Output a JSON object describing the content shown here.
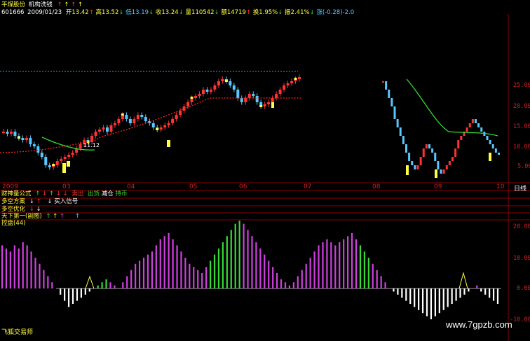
{
  "header": {
    "title_name": "平煤股份",
    "title_formula": "机构洗钱",
    "arrows": [
      "↑",
      "↑",
      "↑",
      "↑"
    ],
    "code": "601666",
    "date": "2009/01/23",
    "open_label": "开13.42",
    "high_label": "高13.52",
    "low_label": "低13.19",
    "close_label": "收13.24",
    "vol_label": "量110542",
    "amt_label": "额14719",
    "turn_label": "换1.95%",
    "amp_label": "振2.41%",
    "chg_label": "涨(-0.28)-2.0"
  },
  "price_panel": {
    "y_ticks": [
      "25.00",
      "20.00",
      "15.00",
      "10.00",
      "5.00"
    ],
    "x_ticks": [
      "2009",
      "03",
      "04",
      "05",
      "06",
      "07",
      "08",
      "09",
      "10"
    ],
    "period_label": "日线",
    "annotation": "11.12"
  },
  "indicator_rows": [
    {
      "label": "财神量公式",
      "signals": [
        "↑",
        "↓",
        "↑",
        "↓",
        "↓"
      ],
      "extra_red": "卖出",
      "extra_green": "出货",
      "extra_white": "减仓",
      "extra_green2": "持币"
    },
    {
      "label": "多空方案",
      "signals": [
        "↓",
        "↑",
        "↓"
      ],
      "extra_white": "买入信号"
    },
    {
      "label": "多空优化",
      "signals": [
        "↓",
        "↓"
      ]
    },
    {
      "label": "天下第一(副图)",
      "signals": [
        "↑",
        "↑",
        "↑",
        "↑"
      ]
    }
  ],
  "osc_panel": {
    "label": "控盘(44)",
    "y_ticks": [
      "20.00",
      "10.00",
      "0.00",
      "-10.00"
    ]
  },
  "footer": {
    "left_label": "飞狐交易师",
    "watermark": "www.7gpzb.com"
  },
  "colors": {
    "red": "#ff3333",
    "cyan": "#58c8ff",
    "yellow": "#ffff40",
    "green": "#33dd33",
    "magenta": "#d040e0",
    "grid_red": "#8a0000",
    "dotted_red": "#ff2020"
  },
  "chart_data": [
    {
      "type": "candlestick",
      "title": "",
      "x_ticks": [
        "2009",
        "03",
        "04",
        "05",
        "06",
        "07",
        "08",
        "09",
        "10"
      ],
      "ylim": [
        2,
        27
      ],
      "series": [
        {
          "name": "",
          "kind": "price_path",
          "values": [
            14,
            13.5,
            14,
            13,
            12.5,
            12,
            12.5,
            11,
            10.5,
            9,
            8,
            6,
            5.5,
            6,
            7,
            7.5,
            8,
            8.5,
            9,
            10,
            11,
            12,
            11.5,
            13,
            14,
            14.5,
            15,
            14,
            15.5,
            16,
            17,
            18,
            17,
            16,
            17,
            18,
            17.5,
            16.5,
            16,
            15,
            14.5,
            15,
            15.5,
            16,
            17,
            18,
            19,
            20,
            21,
            22,
            22.5,
            23,
            24,
            23.5,
            24,
            25,
            26,
            26.5,
            26,
            25,
            24,
            22,
            21,
            22,
            23,
            22.5,
            21,
            20,
            20.5,
            21,
            22,
            23,
            24,
            25,
            25.5,
            26,
            26.5,
            27
          ]
        },
        {
          "name": "",
          "kind": "price_path_2",
          "values": [
            26,
            24,
            22,
            20,
            17,
            15,
            13,
            11,
            9,
            7,
            6,
            5,
            6,
            8,
            10,
            11,
            10,
            9,
            7,
            5,
            4,
            5,
            6,
            7,
            8,
            10,
            12,
            13,
            14,
            15,
            16,
            17,
            16,
            15,
            14,
            13,
            12,
            11,
            10,
            9,
            8.5
          ]
        }
      ]
    },
    {
      "type": "bar",
      "title": "",
      "ylim": [
        -10,
        22
      ],
      "series": [
        {
          "name": "",
          "values": [
            14,
            13,
            12,
            14,
            13,
            15,
            14,
            12,
            10,
            8,
            6,
            4,
            2,
            0,
            -2,
            -4,
            -6,
            -5,
            -4,
            -3,
            -2,
            -1,
            0,
            1,
            2,
            3,
            2,
            1,
            0,
            2,
            4,
            6,
            8,
            9,
            10,
            11,
            12,
            14,
            16,
            17,
            18,
            16,
            14,
            12,
            10,
            8,
            7,
            6,
            5,
            7,
            9,
            11,
            13,
            15,
            17,
            19,
            21,
            22,
            21,
            19,
            17,
            15,
            13,
            11,
            9,
            7,
            5,
            3,
            2,
            1,
            2,
            4,
            6,
            8,
            10,
            12,
            14,
            15,
            16,
            15,
            14,
            15,
            16,
            17,
            18,
            16,
            14,
            12,
            10,
            8,
            6,
            4,
            2,
            0,
            -1,
            -2,
            -3,
            -4,
            -5,
            -6,
            -7,
            -8,
            -9,
            -10,
            -9,
            -8,
            -7,
            -6,
            -5,
            -4,
            -3,
            -2,
            -1,
            0,
            1,
            -1,
            -2,
            -3,
            -4,
            -5
          ]
        }
      ]
    }
  ]
}
